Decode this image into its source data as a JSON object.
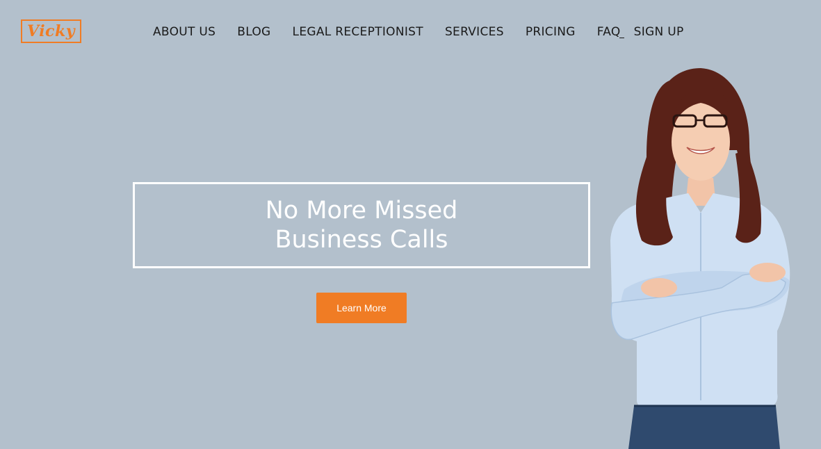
{
  "brand": {
    "logo_text": "Vicky",
    "accent_color": "#f07c24",
    "background_color": "#b3c0cc"
  },
  "nav": {
    "items": [
      {
        "label": "ABOUT US"
      },
      {
        "label": "BLOG"
      },
      {
        "label": "LEGAL RECEPTIONIST"
      },
      {
        "label": "SERVICES"
      },
      {
        "label": "PRICING"
      },
      {
        "label": "FAQ"
      },
      {
        "label": "SIGN UP"
      }
    ]
  },
  "hero": {
    "title_line1": "No More Missed",
    "title_line2": "Business Calls",
    "cta_label": "Learn More",
    "image": "smiling-woman-arms-crossed"
  }
}
